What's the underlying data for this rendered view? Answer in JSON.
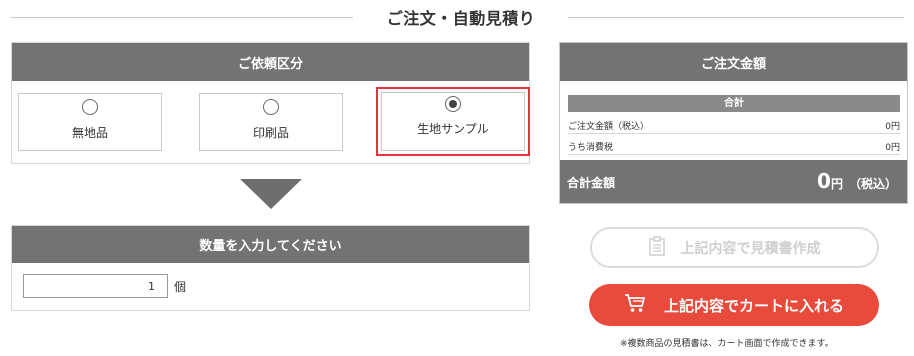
{
  "page_title": "ご注文・自動見積り",
  "order_type": {
    "header": "ご依頼区分",
    "options": [
      {
        "label": "無地品",
        "selected": false
      },
      {
        "label": "印刷品",
        "selected": false
      },
      {
        "label": "生地サンプル",
        "selected": true
      }
    ],
    "highlight_color": "#e6323a"
  },
  "quantity": {
    "header": "数量を入力してください",
    "value": "1",
    "unit": "個"
  },
  "order_total": {
    "header": "ご注文金額",
    "subtotal_label": "合計",
    "rows": [
      {
        "label": "ご注文金額（税込）",
        "value": "0円"
      },
      {
        "label": "うち消費税",
        "value": "0円"
      }
    ],
    "grand_label": "合計金額",
    "grand_amount": "0",
    "grand_unit": "円",
    "grand_tax_note": "（税込）"
  },
  "buttons": {
    "quote_label": "上記内容で見積書作成",
    "quote_icon": "clipboard-icon",
    "cart_label": "上記内容でカートに入れる",
    "cart_icon": "cart-icon",
    "cart_color": "#e84a3c"
  },
  "note": "※複数商品の見積書は、カート画面で作成できます。"
}
